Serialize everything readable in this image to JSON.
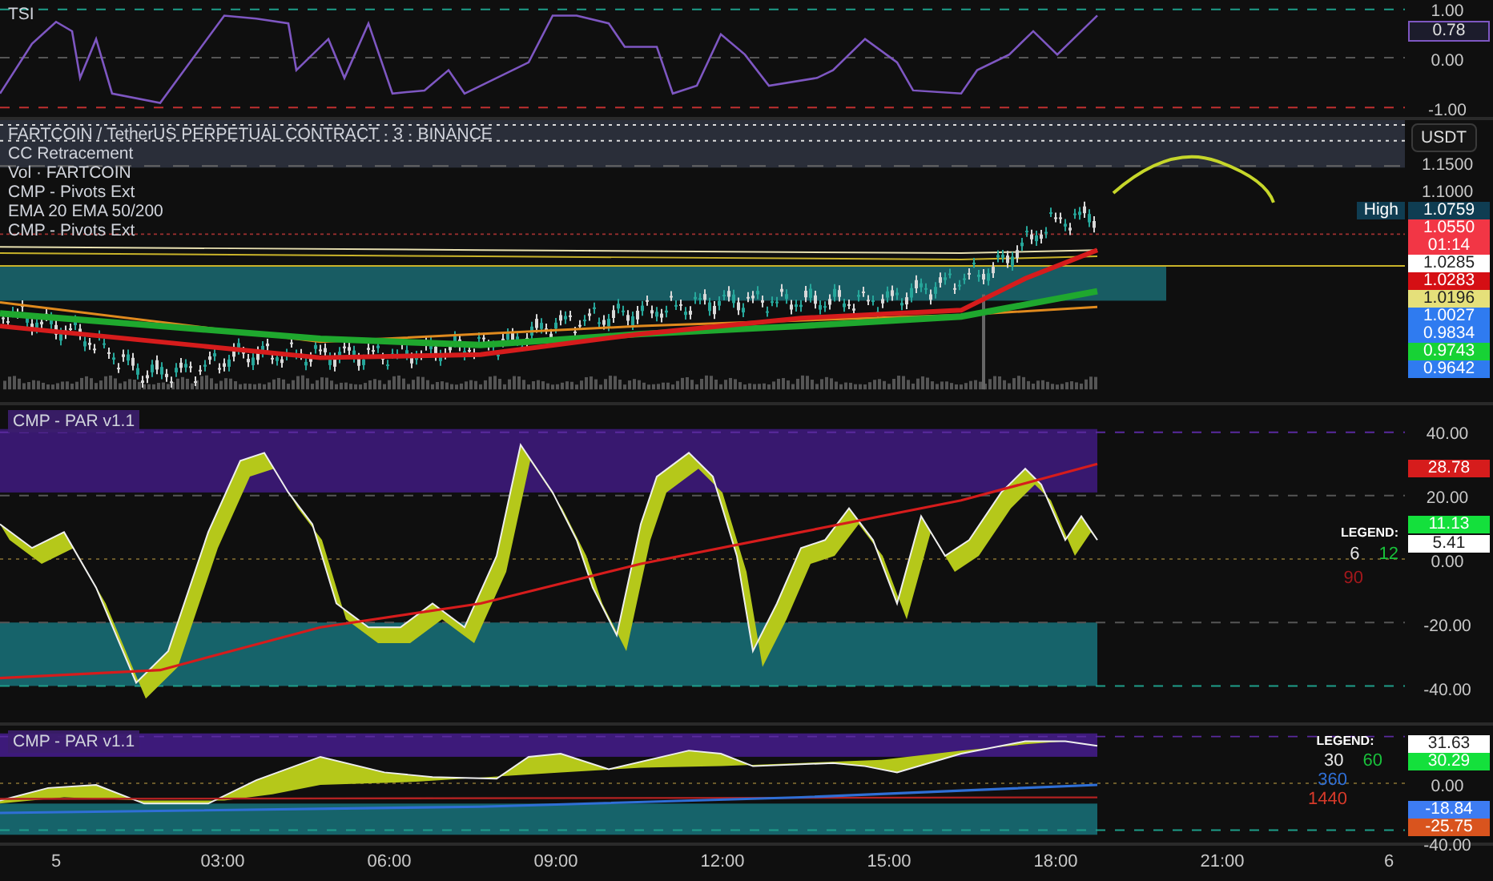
{
  "panes": [
    {
      "kind": "tsi",
      "legend": [
        "TSI"
      ],
      "axis": [
        {
          "text": "1.00"
        },
        {
          "text": "0.78",
          "kind": "outlined",
          "color": "#7e57c2"
        },
        {
          "text": "0.00"
        },
        {
          "text": "-1.00"
        }
      ]
    },
    {
      "kind": "price",
      "legend": [
        "FARTCOIN / TetherUS PERPETUAL CONTRACT · 3 · BINANCE",
        "CC Retracement",
        "Vol · FARTCOIN",
        "CMP - Pivots Ext",
        "EMA 20 EMA 50/200",
        "CMP - Pivots Ext"
      ],
      "currency": "USDT",
      "axis": [
        {
          "text": "1.1500"
        },
        {
          "text": "1.1000"
        },
        {
          "text": "1.0759",
          "kind": "badge",
          "color": "#0f3d52",
          "tag": "High"
        },
        {
          "text": "1.0550",
          "kind": "badge",
          "color": "#f23645",
          "sub": "01:14"
        },
        {
          "text": "1.0285",
          "kind": "badge",
          "color": "#ffffff"
        },
        {
          "text": "1.0283",
          "kind": "badge",
          "color": "#d50f14"
        },
        {
          "text": "1.0196",
          "kind": "badge",
          "color": "#e5e07a"
        },
        {
          "text": "1.0027",
          "kind": "badge",
          "color": "#2f7bf0",
          "sub": "0.9834"
        },
        {
          "text": "0.9743",
          "kind": "badge",
          "color": "#17d235"
        },
        {
          "text": "0.9642",
          "kind": "badge",
          "color": "#2f7bf0"
        }
      ]
    },
    {
      "kind": "par",
      "legend": [
        "CMP - PAR v1.1"
      ],
      "legend_box": {
        "title": "LEGEND:",
        "periods": [
          {
            "text": "6",
            "color": "#e6e6e6"
          },
          {
            "text": "12",
            "color": "#19c13b"
          },
          {
            "text": "90",
            "color": "#a3181c"
          }
        ]
      },
      "axis": [
        {
          "text": "40.00"
        },
        {
          "text": "28.78",
          "kind": "badge",
          "color": "#d61c1c"
        },
        {
          "text": "20.00"
        },
        {
          "text": "11.13",
          "kind": "badge",
          "color": "#14e03c"
        },
        {
          "text": "5.41",
          "kind": "badge",
          "color": "#ffffff"
        },
        {
          "text": "0.00"
        },
        {
          "text": "-20.00"
        },
        {
          "text": "-40.00"
        }
      ]
    },
    {
      "kind": "par_small",
      "legend": [
        "CMP - PAR v1.1"
      ],
      "legend_box": {
        "title": "LEGEND:",
        "periods": [
          {
            "text": "30",
            "color": "#e6e6e6"
          },
          {
            "text": "60",
            "color": "#19c13b"
          },
          {
            "text": "360",
            "color": "#2f6fd6"
          },
          {
            "text": "1440",
            "color": "#d63a2a"
          }
        ]
      },
      "axis": [
        {
          "text": "31.63",
          "kind": "badge",
          "color": "#ffffff"
        },
        {
          "text": "30.29",
          "kind": "badge",
          "color": "#14e03c"
        },
        {
          "text": "0.00"
        },
        {
          "text": "-18.84",
          "kind": "badge",
          "color": "#3d7cf2"
        },
        {
          "text": "-25.75",
          "kind": "badge",
          "color": "#d9541e"
        },
        {
          "text": "-40.00"
        }
      ]
    }
  ],
  "time_axis": [
    "5",
    "03:00",
    "06:00",
    "09:00",
    "12:00",
    "15:00",
    "18:00",
    "21:00",
    "6"
  ]
}
